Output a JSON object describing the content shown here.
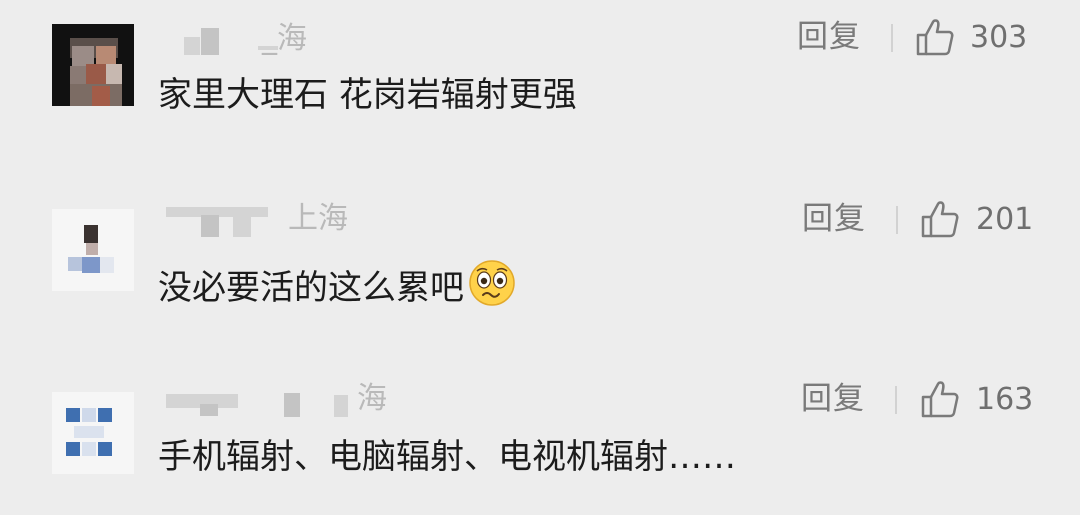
{
  "comments": [
    {
      "location": "_海",
      "reply_label": "回复",
      "likes": "303",
      "text": "家里大理石 花岗岩辐射更强"
    },
    {
      "location": "上海",
      "reply_label": "回复",
      "likes": "201",
      "text": "没必要活的这么累吧",
      "emoji": "worried-face-emoji"
    },
    {
      "location": "海",
      "reply_label": "回复",
      "likes": "163",
      "text": "手机辐射、电脑辐射、电视机辐射……"
    }
  ],
  "icons": {
    "like": "thumbs-up-outline-icon"
  },
  "colors": {
    "background": "#ededed",
    "text": "#1c1c1c",
    "meta": "#7a7a7a",
    "location": "#b9b9b9"
  }
}
